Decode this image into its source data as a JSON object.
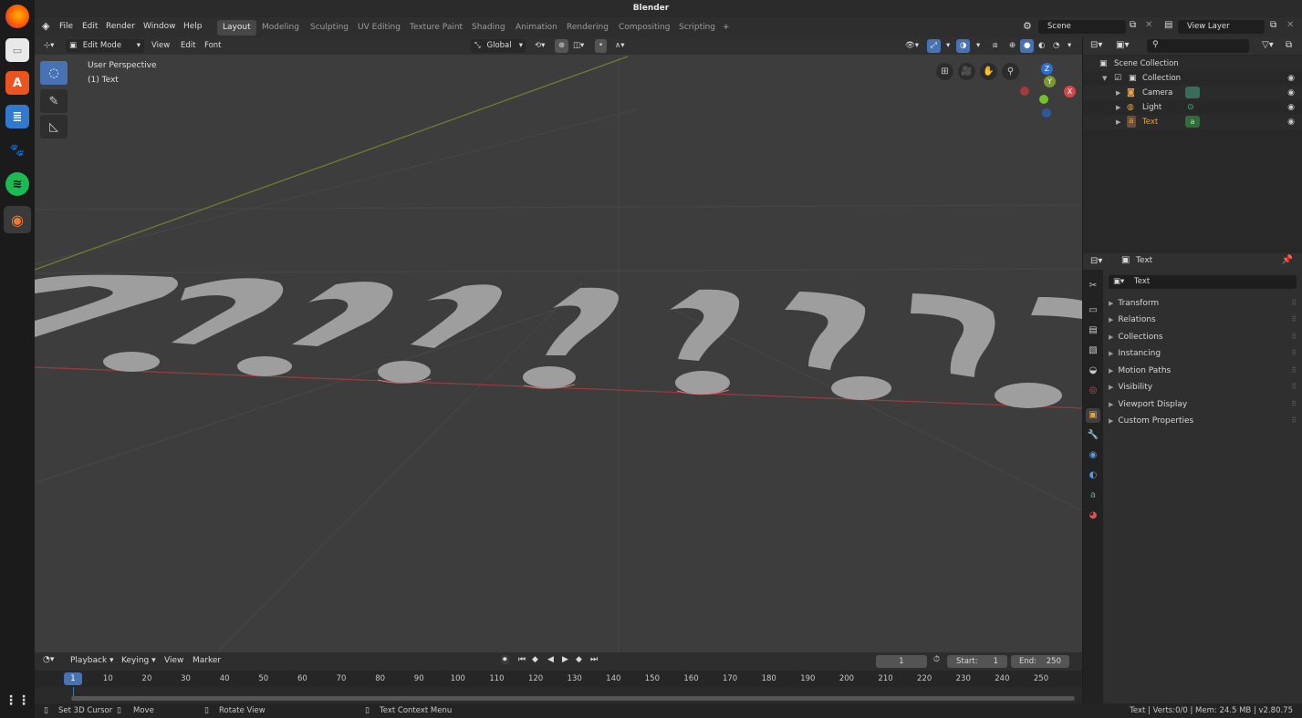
{
  "window_title": "Blender",
  "menu": [
    "File",
    "Edit",
    "Render",
    "Window",
    "Help"
  ],
  "workspace_tabs": [
    "Layout",
    "Modeling",
    "Sculpting",
    "UV Editing",
    "Texture Paint",
    "Shading",
    "Animation",
    "Rendering",
    "Compositing",
    "Scripting"
  ],
  "active_workspace": "Layout",
  "add_workspace_icon": "plus-icon",
  "scene_field": "Scene",
  "view_layer_field": "View Layer",
  "viewport_header": {
    "mode": "Edit Mode",
    "view": "View",
    "edit": "Edit",
    "font": "Font",
    "orientation": "Global"
  },
  "viewport_overlay": {
    "perspective": "User Perspective",
    "object": "(1) Text"
  },
  "gizmo": {
    "z": "Z",
    "y": "Y",
    "x": "X"
  },
  "outliner": {
    "scene_collection": "Scene Collection",
    "collection": "Collection",
    "items": [
      {
        "name": "Camera",
        "color": "#d8d8d8"
      },
      {
        "name": "Light",
        "color": "#d8d8d8"
      },
      {
        "name": "Text",
        "color": "#e8a33a"
      }
    ]
  },
  "properties": {
    "header_title": "Text",
    "object_name": "Text",
    "panels": [
      "Transform",
      "Relations",
      "Collections",
      "Instancing",
      "Motion Paths",
      "Visibility",
      "Viewport Display",
      "Custom Properties"
    ]
  },
  "timeline": {
    "playback": "Playback",
    "keying": "Keying",
    "view": "View",
    "marker": "Marker",
    "current_frame": "1",
    "start_label": "Start:",
    "start": "1",
    "end_label": "End:",
    "end": "250",
    "ruler_labels": [
      "1",
      "10",
      "20",
      "30",
      "40",
      "50",
      "60",
      "70",
      "80",
      "90",
      "100",
      "110",
      "120",
      "130",
      "140",
      "150",
      "160",
      "170",
      "180",
      "190",
      "200",
      "210",
      "220",
      "230",
      "240",
      "250"
    ]
  },
  "statusbar": {
    "set_cursor": "Set 3D Cursor",
    "move": "Move",
    "rotate": "Rotate View",
    "context": "Text Context Menu",
    "stats": "Text | Verts:0/0 | Mem: 24.5 MB | v2.80.75"
  },
  "dock_apps": [
    "firefox-icon",
    "files-icon",
    "software-icon",
    "writer-icon",
    "gimp-icon",
    "spotify-icon",
    "blender-icon",
    "apps-grid-icon"
  ],
  "colors": {
    "accent": "#4772b3",
    "x_axis": "#c04a4a",
    "y_axis": "#7a9a2c",
    "active_object": "#e8a33a"
  }
}
